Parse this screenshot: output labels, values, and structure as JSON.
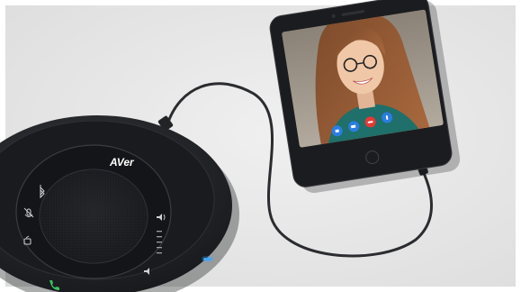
{
  "brand": {
    "logo_text": "AVer"
  },
  "colors": {
    "background": "#e8e8e8",
    "frame": "#ffffff",
    "speaker_body": "#1f2124",
    "speaker_panel": "#141518",
    "phone_body": "#1b1c1f",
    "cable": "#2b2c2f",
    "led_blue": "#3ba6ff",
    "call_end_red": "#e53935",
    "call_blue": "#2a7de1",
    "phone_icon_green": "#39c262"
  },
  "icons": [
    "bluetooth-icon",
    "mic-mute-icon",
    "hook-icon",
    "volume-up-icon",
    "volume-down-icon",
    "call-answer-icon",
    "call-end-icon",
    "video-icon",
    "chat-icon",
    "mute-icon"
  ]
}
